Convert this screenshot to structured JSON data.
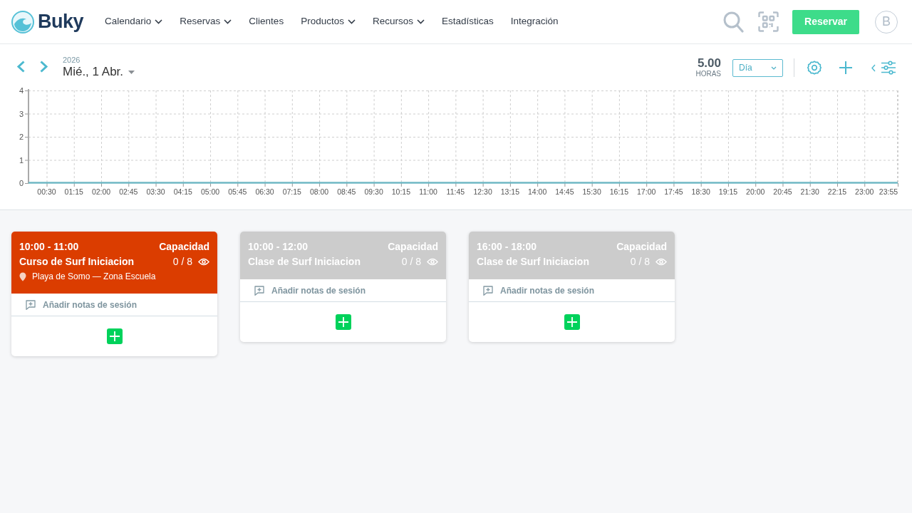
{
  "brand": {
    "name": "Buky"
  },
  "nav": [
    {
      "label": "Calendario",
      "dropdown": true
    },
    {
      "label": "Reservas",
      "dropdown": true
    },
    {
      "label": "Clientes",
      "dropdown": false
    },
    {
      "label": "Productos",
      "dropdown": true
    },
    {
      "label": "Recursos",
      "dropdown": true
    },
    {
      "label": "Estadísticas",
      "dropdown": false
    },
    {
      "label": "Integración",
      "dropdown": false
    }
  ],
  "header_actions": {
    "book_button": "Reservar",
    "avatar_initial": "B"
  },
  "toolbar": {
    "year": "2026",
    "date": "Mié., 1 Abr.",
    "hours_value": "5.00",
    "hours_label": "HORAS",
    "view_select": "Día"
  },
  "usage_chart": {
    "chart_data": {
      "type": "line",
      "grid": true,
      "x": [
        0,
        1435
      ],
      "series": [
        {
          "color": "#6fb8c4",
          "values": [
            0,
            0
          ]
        }
      ],
      "xlim": [
        0,
        1435
      ],
      "ylim": [
        0,
        4
      ],
      "yticks": [
        0,
        1,
        2,
        3,
        4
      ],
      "xticks": [
        {
          "value": 30,
          "label": "00:30"
        },
        {
          "value": 75,
          "label": "01:15"
        },
        {
          "value": 120,
          "label": "02:00"
        },
        {
          "value": 165,
          "label": "02:45"
        },
        {
          "value": 210,
          "label": "03:30"
        },
        {
          "value": 255,
          "label": "04:15"
        },
        {
          "value": 300,
          "label": "05:00"
        },
        {
          "value": 345,
          "label": "05:45"
        },
        {
          "value": 390,
          "label": "06:30"
        },
        {
          "value": 435,
          "label": "07:15"
        },
        {
          "value": 480,
          "label": "08:00"
        },
        {
          "value": 525,
          "label": "08:45"
        },
        {
          "value": 570,
          "label": "09:30"
        },
        {
          "value": 615,
          "label": "10:15"
        },
        {
          "value": 660,
          "label": "11:00"
        },
        {
          "value": 705,
          "label": "11:45"
        },
        {
          "value": 750,
          "label": "12:30"
        },
        {
          "value": 795,
          "label": "13:15"
        },
        {
          "value": 840,
          "label": "14:00"
        },
        {
          "value": 885,
          "label": "14:45"
        },
        {
          "value": 930,
          "label": "15:30"
        },
        {
          "value": 975,
          "label": "16:15"
        },
        {
          "value": 1020,
          "label": "17:00"
        },
        {
          "value": 1065,
          "label": "17:45"
        },
        {
          "value": 1110,
          "label": "18:30"
        },
        {
          "value": 1155,
          "label": "19:15"
        },
        {
          "value": 1200,
          "label": "20:00"
        },
        {
          "value": 1245,
          "label": "20:45"
        },
        {
          "value": 1290,
          "label": "21:30"
        },
        {
          "value": 1335,
          "label": "22:15"
        },
        {
          "value": 1380,
          "label": "23:00"
        },
        {
          "value": 1435,
          "label": "23:55"
        }
      ]
    }
  },
  "sessions": [
    {
      "time": "10:00 - 11:00",
      "title": "Curso de Surf Iniciacion",
      "location": "Playa de Somo — Zona Escuela",
      "capacity_label": "Capacidad",
      "capacity": "0 / 8",
      "notes_label": "Añadir notas de sesión",
      "color": "#db3d00"
    },
    {
      "time": "10:00 - 12:00",
      "title": "Clase de Surf Iniciacion",
      "capacity_label": "Capacidad",
      "capacity": "0 / 8",
      "notes_label": "Añadir notas de sesión",
      "color": "#cccccc"
    },
    {
      "time": "16:00 - 18:00",
      "title": "Clase de Surf Iniciacion",
      "capacity_label": "Capacidad",
      "capacity": "0 / 8",
      "notes_label": "Añadir notas de sesión",
      "color": "#cccccc"
    }
  ]
}
